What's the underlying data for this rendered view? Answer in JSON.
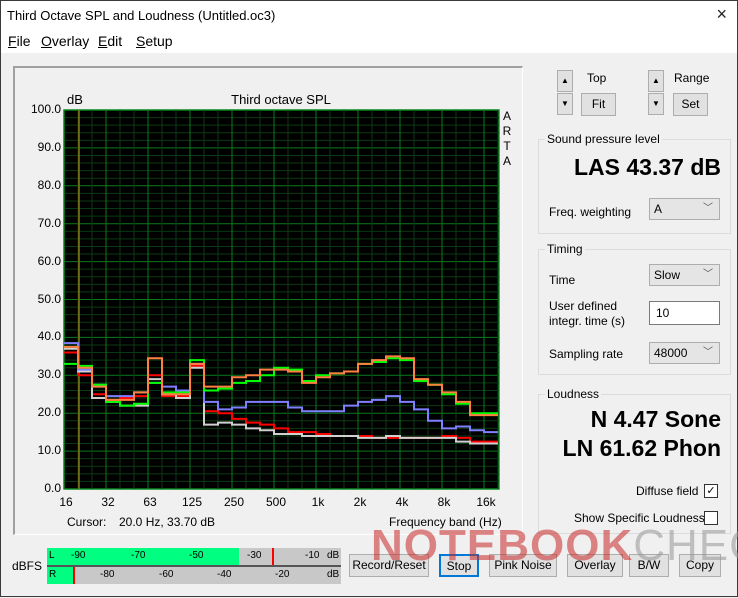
{
  "window": {
    "title": "Third Octave SPL and Loudness (Untitled.oc3)",
    "close_icon": "×"
  },
  "menu": [
    "File",
    "Overlay",
    "Edit",
    "Setup"
  ],
  "plot_controls": {
    "top_label": "Top",
    "fit_label": "Fit",
    "range_label": "Range",
    "set_label": "Set",
    "up_icon": "▲",
    "down_icon": "▼"
  },
  "spl": {
    "group_title": "Sound pressure level",
    "value": "LAS 43.37 dB",
    "freq_weighting_label": "Freq. weighting",
    "freq_weighting_value": "A"
  },
  "timing": {
    "group_title": "Timing",
    "time_label": "Time",
    "time_value": "Slow",
    "integr_label_1": "User defined",
    "integr_label_2": "integr. time (s)",
    "integr_value": "10",
    "sampling_label": "Sampling rate",
    "sampling_value": "48000"
  },
  "loudness": {
    "group_title": "Loudness",
    "sone": "N 4.47 Sone",
    "phon": "LN 61.62 Phon",
    "diffuse_label": "Diffuse field",
    "diffuse_checked": true,
    "specific_label": "Show Specific Loudness",
    "specific_checked": false
  },
  "cursor": {
    "label": "Cursor:",
    "value": "20.0 Hz, 33.70 dB"
  },
  "side_text": [
    "A",
    "R",
    "T",
    "A"
  ],
  "meter": {
    "label": "dBFS",
    "left_label": "L",
    "right_label": "R",
    "left_ticks": [
      "-90",
      "-70",
      "-50",
      "-30",
      "-10",
      "dB"
    ],
    "right_ticks": [
      "-80",
      "-60",
      "-40",
      "-20",
      "dB"
    ],
    "left_level_dbfs": -34,
    "left_peak_dbfs": -22,
    "right_level_dbfs": -95,
    "right_peak_dbfs": -95
  },
  "buttons": [
    "Record/Reset",
    "Stop",
    "Pink Noise",
    "Overlay",
    "B/W",
    "Copy"
  ],
  "watermark": {
    "text_a": "NOTEBOOK",
    "text_b": "CHECK"
  },
  "chart_data": {
    "type": "line",
    "title": "Third octave SPL",
    "xlabel": "Frequency band (Hz)",
    "ylabel": "dB",
    "ylim": [
      0,
      100
    ],
    "yticks": [
      "0.0",
      "10.0",
      "20.0",
      "30.0",
      "40.0",
      "50.0",
      "60.0",
      "70.0",
      "80.0",
      "90.0",
      "100.0"
    ],
    "xtick_labels": [
      "16",
      "32",
      "63",
      "125",
      "250",
      "500",
      "1k",
      "2k",
      "4k",
      "8k",
      "16k"
    ],
    "grid": true,
    "cursor_hz": 20,
    "bands": [
      "16",
      "20",
      "25",
      "31.5",
      "40",
      "50",
      "63",
      "80",
      "100",
      "125",
      "160",
      "200",
      "250",
      "315",
      "400",
      "500",
      "630",
      "800",
      "1k",
      "1.25k",
      "1.6k",
      "2k",
      "2.5k",
      "3.15k",
      "4k",
      "5k",
      "6.3k",
      "8k",
      "10k",
      "12.5k",
      "16k"
    ],
    "series": [
      {
        "name": "red",
        "color": "#ff0000",
        "values": [
          36,
          30,
          25,
          23.5,
          24,
          24.5,
          30,
          24.5,
          24.5,
          32.5,
          20.5,
          20,
          18.5,
          17.5,
          17,
          16,
          15,
          15,
          14.5,
          14,
          14,
          14,
          13.5,
          13.5,
          13.5,
          13.5,
          13.5,
          14,
          13.5,
          12.5,
          12.5
        ]
      },
      {
        "name": "white",
        "color": "#d0d0d0",
        "values": [
          37,
          31,
          24,
          23,
          22,
          22,
          29,
          25,
          24,
          32,
          17,
          17.5,
          17,
          16,
          15.5,
          14.5,
          14.5,
          14,
          14,
          14,
          14,
          13.5,
          13.5,
          14,
          13.5,
          13.5,
          13.5,
          13.5,
          12.5,
          12,
          12
        ]
      },
      {
        "name": "blue",
        "color": "#8080ff",
        "values": [
          38.5,
          31.5,
          27.5,
          24.5,
          24.5,
          25.5,
          28,
          27,
          26,
          33,
          23,
          21,
          21.5,
          23,
          23,
          23,
          21.5,
          20.5,
          20.5,
          20.5,
          22,
          23,
          23.5,
          24.5,
          23,
          21,
          18,
          16,
          16.5,
          15.5,
          15
        ]
      },
      {
        "name": "green",
        "color": "#00ff00",
        "values": [
          33,
          32.5,
          27.5,
          23,
          22,
          22.5,
          28,
          25.5,
          25.5,
          34,
          26,
          26.5,
          28,
          28.5,
          30,
          32,
          31.5,
          28.5,
          30,
          30.5,
          31,
          33,
          33.5,
          34.5,
          34,
          28.5,
          27.5,
          25,
          22.5,
          20,
          20
        ]
      },
      {
        "name": "orange",
        "color": "#ff8040",
        "values": [
          37.5,
          32,
          27,
          23.5,
          23.5,
          25.5,
          34.5,
          25,
          25,
          33,
          27,
          27,
          29.5,
          30,
          31.5,
          31.5,
          31,
          28,
          29.5,
          30.5,
          31,
          33,
          34,
          35,
          34.5,
          29,
          27.5,
          25.5,
          23,
          19.5,
          19.5
        ]
      }
    ]
  }
}
